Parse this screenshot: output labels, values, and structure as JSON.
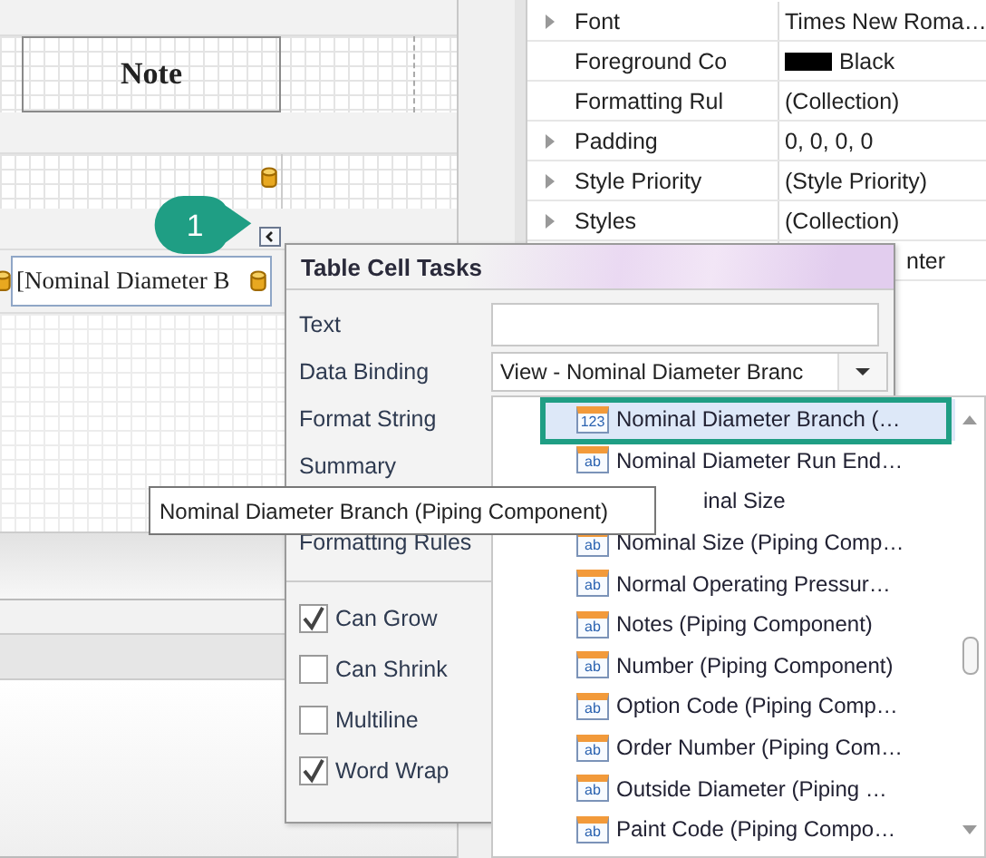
{
  "designer": {
    "header_cell": "Note",
    "data_cell": "[Nominal Diameter B"
  },
  "properties": [
    {
      "name": "Font",
      "value": "Times New Roma…",
      "expandable": true
    },
    {
      "name": "Foreground Co",
      "value": "Black",
      "expandable": false,
      "color": "#000000"
    },
    {
      "name": "Formatting Rul",
      "value": "(Collection)",
      "expandable": false
    },
    {
      "name": "Padding",
      "value": "0, 0, 0, 0",
      "expandable": true
    },
    {
      "name": "Style Priority",
      "value": "(Style Priority)",
      "expandable": true
    },
    {
      "name": "Styles",
      "value": "(Collection)",
      "expandable": true
    },
    {
      "value": "nter"
    }
  ],
  "callout": {
    "number": "1"
  },
  "popup": {
    "title": "Table Cell Tasks",
    "fields": [
      {
        "label": "Text",
        "kind": "text"
      },
      {
        "label": "Data Binding",
        "kind": "combo",
        "value": "View - Nominal Diameter Branc"
      },
      {
        "label": "Format String",
        "kind": "label"
      },
      {
        "label": "Summary",
        "kind": "label"
      },
      {
        "label": "Formatting Rules",
        "kind": "label"
      }
    ],
    "checkboxes": [
      {
        "label": "Can Grow",
        "checked": true
      },
      {
        "label": "Can Shrink",
        "checked": false
      },
      {
        "label": "Multiline",
        "checked": false
      },
      {
        "label": "Word Wrap",
        "checked": true
      }
    ]
  },
  "dropdown": {
    "items": [
      {
        "text": "Nominal Diameter Branch (…",
        "icon": "123",
        "selected": true
      },
      {
        "text": "Nominal Diameter Run End…",
        "icon": "ab",
        "selected": false
      },
      {
        "text": "inal Size",
        "selected": false
      },
      {
        "text": "Nominal Size (Piping Comp…",
        "icon": "ab",
        "selected": false
      },
      {
        "text": "Normal Operating Pressur…",
        "icon": "ab",
        "selected": false
      },
      {
        "text": "Notes (Piping Component)",
        "icon": "ab",
        "selected": false
      },
      {
        "text": "Number (Piping Component)",
        "icon": "ab",
        "selected": false
      },
      {
        "text": "Option Code (Piping Comp…",
        "icon": "ab",
        "selected": false
      },
      {
        "text": "Order Number (Piping Com…",
        "icon": "ab",
        "selected": false
      },
      {
        "text": "Outside Diameter (Piping …",
        "icon": "ab",
        "selected": false
      },
      {
        "text": "Paint Code (Piping Compo…",
        "icon": "ab",
        "selected": false
      }
    ]
  },
  "tooltip": {
    "text": "Nominal Diameter Branch (Piping Component)"
  }
}
